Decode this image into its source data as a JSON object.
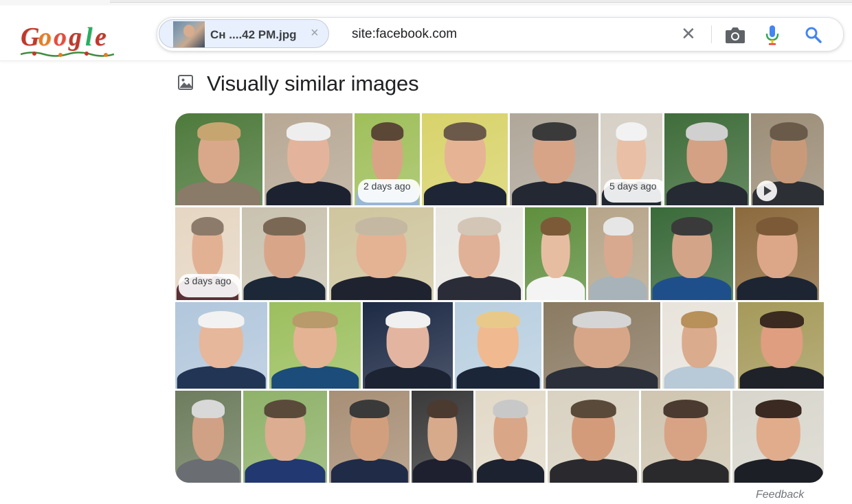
{
  "logo": {
    "letters": [
      "G",
      "o",
      "o",
      "g",
      "l",
      "e"
    ],
    "colors": [
      "#c0392b",
      "#e67e22",
      "#e74c3c",
      "#c0392b",
      "#27ae60",
      "#c0392b"
    ]
  },
  "search": {
    "chip_label": "Cн ....42 PM.jpg",
    "chip_close": "×",
    "query": "site:facebook.com",
    "clear": "✕"
  },
  "icons": {
    "camera": "camera-icon",
    "mic": "microphone-icon",
    "search": "search-icon",
    "image": "image-icon"
  },
  "section": {
    "title": "Visually similar images"
  },
  "rows": [
    [
      {
        "bg": "#4e7a3c",
        "face": "#d9a88a",
        "suit": "#8a7a68",
        "hair": "#c7a571"
      },
      {
        "bg": "#b7a894",
        "face": "#e3b49b",
        "suit": "#1c2230",
        "hair": "#eeeeee"
      },
      {
        "bg": "#9fbf5a",
        "face": "#d9a486",
        "suit": "#9ab5d6",
        "hair": "#5a4736",
        "badge": "2 days ago"
      },
      {
        "bg": "#d8d36a",
        "face": "#e6b495",
        "suit": "#1e2636",
        "hair": "#6b5a4a"
      },
      {
        "bg": "#b0a79a",
        "face": "#d8a487",
        "suit": "#232833",
        "hair": "#3a3a3a"
      },
      {
        "bg": "#d6d0c6",
        "face": "#e9c0a6",
        "suit": "#222833",
        "hair": "#f2f2f2",
        "badge": "5 days ago"
      },
      {
        "bg": "#3f6d3a",
        "face": "#d4a184",
        "suit": "#262a33",
        "hair": "#d0d0d0"
      },
      {
        "bg": "#9c8e78",
        "face": "#c99a7a",
        "suit": "#2c2f33",
        "hair": "#6a5a4a",
        "play": true
      }
    ],
    [
      {
        "bg": "#e6d6c3",
        "face": "#e2b193",
        "suit": "#5a2f35",
        "hair": "#8c7b6a",
        "badge": "3 days ago"
      },
      {
        "bg": "#c9c2b0",
        "face": "#d9a589",
        "suit": "#1c2838",
        "hair": "#7a6855"
      },
      {
        "bg": "#cfc59e",
        "face": "#e3b394",
        "suit": "#1f2330",
        "hair": "#c5b8a2"
      },
      {
        "bg": "#e9e7e2",
        "face": "#e0b196",
        "suit": "#2a2d38",
        "hair": "#d3c6b6"
      },
      {
        "bg": "#5f8f3e",
        "face": "#e7bda2",
        "suit": "#f4f4f4",
        "hair": "#7c5a38"
      },
      {
        "bg": "#b6a58a",
        "face": "#d8a98e",
        "suit": "#a7b3b8",
        "hair": "#e6e6e6"
      },
      {
        "bg": "#3a6a3a",
        "face": "#d4a488",
        "suit": "#1f4f8a",
        "hair": "#3b3a3a"
      },
      {
        "bg": "#8c6a3e",
        "face": "#dca789",
        "suit": "#1d2533",
        "hair": "#7c5a38"
      }
    ],
    [
      {
        "bg": "#b2c7dc",
        "face": "#e6b79b",
        "suit": "#223555",
        "hair": "#f2f2f2"
      },
      {
        "bg": "#9cbf5e",
        "face": "#e4b394",
        "suit": "#1b4c7a",
        "hair": "#b99a6a"
      },
      {
        "bg": "#1d2a45",
        "face": "#e3b5a0",
        "suit": "#1c2332",
        "hair": "#f0f0f0"
      },
      {
        "bg": "#b8cfe0",
        "face": "#f0b990",
        "suit": "#1b2638",
        "hair": "#e8c98a"
      },
      {
        "bg": "#8a7a62",
        "face": "#d7a689",
        "suit": "#2a2f3a",
        "hair": "#d5d5d5"
      },
      {
        "bg": "#e8e4dc",
        "face": "#dbab8d",
        "suit": "#b8c9d8",
        "hair": "#b8905a"
      },
      {
        "bg": "#a59a5a",
        "face": "#de9e7f",
        "suit": "#1f2228",
        "hair": "#3a2a20"
      }
    ],
    [
      {
        "bg": "#6e7d5e",
        "face": "#d0a184",
        "suit": "#6a6e72",
        "hair": "#d8d8d8"
      },
      {
        "bg": "#8fb26a",
        "face": "#dcad90",
        "suit": "#223870",
        "hair": "#5a4a3a"
      },
      {
        "bg": "#a88f76",
        "face": "#d29f7e",
        "suit": "#202b48",
        "hair": "#3a3a3a"
      },
      {
        "bg": "#3a3a3a",
        "face": "#d7aa8c",
        "suit": "#1e2030",
        "hair": "#4a3a30"
      },
      {
        "bg": "#e2d9c8",
        "face": "#d9a688",
        "suit": "#1d2230",
        "hair": "#c8c8c8"
      },
      {
        "bg": "#d9d2c2",
        "face": "#d49b7b",
        "suit": "#2a2a2e",
        "hair": "#5a4a3a"
      },
      {
        "bg": "#cfc5b0",
        "face": "#d8a384",
        "suit": "#2a2a2c",
        "hair": "#4a3a30"
      },
      {
        "bg": "#d8d6cc",
        "face": "#e0ac8c",
        "suit": "#1c1f26",
        "hair": "#3a2a22"
      }
    ]
  ],
  "feedback": "Feedback"
}
